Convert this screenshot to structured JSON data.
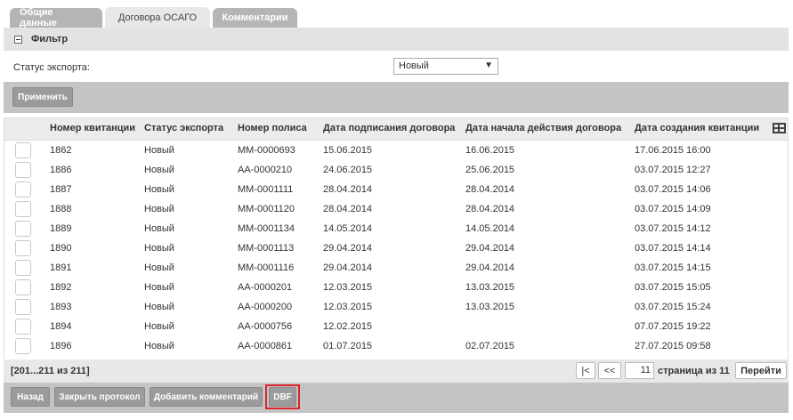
{
  "tabs": [
    {
      "label": "Общие данные",
      "active": false
    },
    {
      "label": "Договора ОСАГО",
      "active": true
    },
    {
      "label": "Комментарии",
      "active": false
    }
  ],
  "filter": {
    "title": "Фильтр",
    "status_label": "Статус экспорта:",
    "status_value": "Новый",
    "apply_label": "Применить"
  },
  "table": {
    "columns": [
      "Номер квитанции",
      "Статус экспорта",
      "Номер полиса",
      "Дата подписания договора",
      "Дата начала действия договора",
      "Дата создания квитанции"
    ],
    "rows": [
      [
        "1862",
        "Новый",
        "MM-0000693",
        "15.06.2015",
        "16.06.2015",
        "17.06.2015 16:00"
      ],
      [
        "1886",
        "Новый",
        "AA-0000210",
        "24.06.2015",
        "25.06.2015",
        "03.07.2015 12:27"
      ],
      [
        "1887",
        "Новый",
        "MM-0001111",
        "28.04.2014",
        "28.04.2014",
        "03.07.2015 14:06"
      ],
      [
        "1888",
        "Новый",
        "MM-0001120",
        "28.04.2014",
        "28.04.2014",
        "03.07.2015 14:09"
      ],
      [
        "1889",
        "Новый",
        "MM-0001134",
        "14.05.2014",
        "14.05.2014",
        "03.07.2015 14:12"
      ],
      [
        "1890",
        "Новый",
        "MM-0001113",
        "29.04.2014",
        "29.04.2014",
        "03.07.2015 14:14"
      ],
      [
        "1891",
        "Новый",
        "MM-0001116",
        "29.04.2014",
        "29.04.2014",
        "03.07.2015 14:15"
      ],
      [
        "1892",
        "Новый",
        "AA-0000201",
        "12.03.2015",
        "13.03.2015",
        "03.07.2015 15:05"
      ],
      [
        "1893",
        "Новый",
        "AA-0000200",
        "12.03.2015",
        "13.03.2015",
        "03.07.2015 15:24"
      ],
      [
        "1894",
        "Новый",
        "AA-0000756",
        "12.02.2015",
        "",
        "07.07.2015 19:22"
      ],
      [
        "1896",
        "Новый",
        "AA-0000861",
        "01.07.2015",
        "02.07.2015",
        "27.07.2015 09:58"
      ]
    ]
  },
  "pager": {
    "info": "[201...211 из 211]",
    "first_label": "|<",
    "prev_label": "<<",
    "page_value": "11",
    "of_label": "страница из 11",
    "go_label": "Перейти"
  },
  "actions": {
    "back_label": "Назад",
    "close_protocol_label": "Закрыть протокол",
    "add_comment_label": "Добавить комментарий",
    "dbf_label": "DBF"
  },
  "colors": {
    "highlight": "#d9232d",
    "button_bg": "#9b9b9b"
  }
}
